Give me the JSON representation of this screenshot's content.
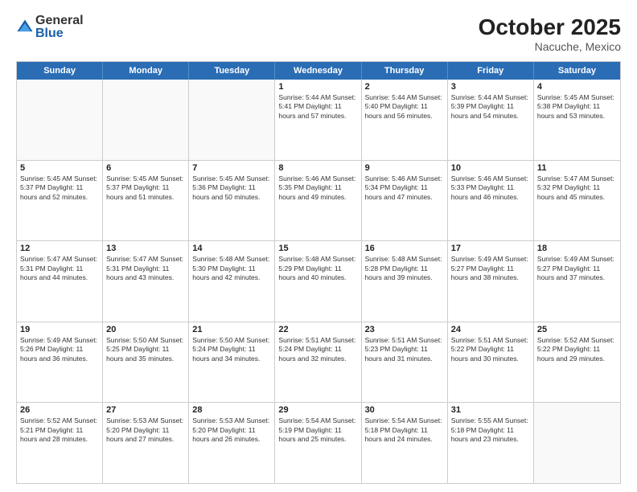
{
  "logo": {
    "general": "General",
    "blue": "Blue"
  },
  "title": "October 2025",
  "subtitle": "Nacuche, Mexico",
  "days_of_week": [
    "Sunday",
    "Monday",
    "Tuesday",
    "Wednesday",
    "Thursday",
    "Friday",
    "Saturday"
  ],
  "weeks": [
    [
      {
        "day": "",
        "info": ""
      },
      {
        "day": "",
        "info": ""
      },
      {
        "day": "",
        "info": ""
      },
      {
        "day": "1",
        "info": "Sunrise: 5:44 AM\nSunset: 5:41 PM\nDaylight: 11 hours\nand 57 minutes."
      },
      {
        "day": "2",
        "info": "Sunrise: 5:44 AM\nSunset: 5:40 PM\nDaylight: 11 hours\nand 56 minutes."
      },
      {
        "day": "3",
        "info": "Sunrise: 5:44 AM\nSunset: 5:39 PM\nDaylight: 11 hours\nand 54 minutes."
      },
      {
        "day": "4",
        "info": "Sunrise: 5:45 AM\nSunset: 5:38 PM\nDaylight: 11 hours\nand 53 minutes."
      }
    ],
    [
      {
        "day": "5",
        "info": "Sunrise: 5:45 AM\nSunset: 5:37 PM\nDaylight: 11 hours\nand 52 minutes."
      },
      {
        "day": "6",
        "info": "Sunrise: 5:45 AM\nSunset: 5:37 PM\nDaylight: 11 hours\nand 51 minutes."
      },
      {
        "day": "7",
        "info": "Sunrise: 5:45 AM\nSunset: 5:36 PM\nDaylight: 11 hours\nand 50 minutes."
      },
      {
        "day": "8",
        "info": "Sunrise: 5:46 AM\nSunset: 5:35 PM\nDaylight: 11 hours\nand 49 minutes."
      },
      {
        "day": "9",
        "info": "Sunrise: 5:46 AM\nSunset: 5:34 PM\nDaylight: 11 hours\nand 47 minutes."
      },
      {
        "day": "10",
        "info": "Sunrise: 5:46 AM\nSunset: 5:33 PM\nDaylight: 11 hours\nand 46 minutes."
      },
      {
        "day": "11",
        "info": "Sunrise: 5:47 AM\nSunset: 5:32 PM\nDaylight: 11 hours\nand 45 minutes."
      }
    ],
    [
      {
        "day": "12",
        "info": "Sunrise: 5:47 AM\nSunset: 5:31 PM\nDaylight: 11 hours\nand 44 minutes."
      },
      {
        "day": "13",
        "info": "Sunrise: 5:47 AM\nSunset: 5:31 PM\nDaylight: 11 hours\nand 43 minutes."
      },
      {
        "day": "14",
        "info": "Sunrise: 5:48 AM\nSunset: 5:30 PM\nDaylight: 11 hours\nand 42 minutes."
      },
      {
        "day": "15",
        "info": "Sunrise: 5:48 AM\nSunset: 5:29 PM\nDaylight: 11 hours\nand 40 minutes."
      },
      {
        "day": "16",
        "info": "Sunrise: 5:48 AM\nSunset: 5:28 PM\nDaylight: 11 hours\nand 39 minutes."
      },
      {
        "day": "17",
        "info": "Sunrise: 5:49 AM\nSunset: 5:27 PM\nDaylight: 11 hours\nand 38 minutes."
      },
      {
        "day": "18",
        "info": "Sunrise: 5:49 AM\nSunset: 5:27 PM\nDaylight: 11 hours\nand 37 minutes."
      }
    ],
    [
      {
        "day": "19",
        "info": "Sunrise: 5:49 AM\nSunset: 5:26 PM\nDaylight: 11 hours\nand 36 minutes."
      },
      {
        "day": "20",
        "info": "Sunrise: 5:50 AM\nSunset: 5:25 PM\nDaylight: 11 hours\nand 35 minutes."
      },
      {
        "day": "21",
        "info": "Sunrise: 5:50 AM\nSunset: 5:24 PM\nDaylight: 11 hours\nand 34 minutes."
      },
      {
        "day": "22",
        "info": "Sunrise: 5:51 AM\nSunset: 5:24 PM\nDaylight: 11 hours\nand 32 minutes."
      },
      {
        "day": "23",
        "info": "Sunrise: 5:51 AM\nSunset: 5:23 PM\nDaylight: 11 hours\nand 31 minutes."
      },
      {
        "day": "24",
        "info": "Sunrise: 5:51 AM\nSunset: 5:22 PM\nDaylight: 11 hours\nand 30 minutes."
      },
      {
        "day": "25",
        "info": "Sunrise: 5:52 AM\nSunset: 5:22 PM\nDaylight: 11 hours\nand 29 minutes."
      }
    ],
    [
      {
        "day": "26",
        "info": "Sunrise: 5:52 AM\nSunset: 5:21 PM\nDaylight: 11 hours\nand 28 minutes."
      },
      {
        "day": "27",
        "info": "Sunrise: 5:53 AM\nSunset: 5:20 PM\nDaylight: 11 hours\nand 27 minutes."
      },
      {
        "day": "28",
        "info": "Sunrise: 5:53 AM\nSunset: 5:20 PM\nDaylight: 11 hours\nand 26 minutes."
      },
      {
        "day": "29",
        "info": "Sunrise: 5:54 AM\nSunset: 5:19 PM\nDaylight: 11 hours\nand 25 minutes."
      },
      {
        "day": "30",
        "info": "Sunrise: 5:54 AM\nSunset: 5:18 PM\nDaylight: 11 hours\nand 24 minutes."
      },
      {
        "day": "31",
        "info": "Sunrise: 5:55 AM\nSunset: 5:18 PM\nDaylight: 11 hours\nand 23 minutes."
      },
      {
        "day": "",
        "info": ""
      }
    ]
  ]
}
